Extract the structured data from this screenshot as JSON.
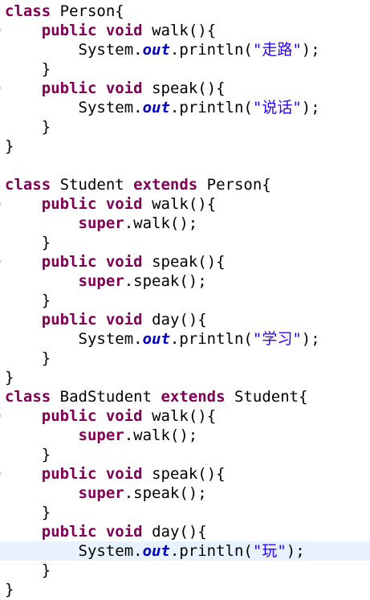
{
  "editor": {
    "current_line": 28,
    "lines": [
      {
        "indent": 0,
        "tokens": [
          {
            "t": "class",
            "c": "kw"
          },
          {
            "t": " Person{",
            "c": "plain"
          }
        ]
      },
      {
        "indent": 1,
        "mark": true,
        "tokens": [
          {
            "t": "public",
            "c": "kw"
          },
          {
            "t": " ",
            "c": "plain"
          },
          {
            "t": "void",
            "c": "kw"
          },
          {
            "t": " walk(){",
            "c": "plain"
          }
        ]
      },
      {
        "indent": 2,
        "tokens": [
          {
            "t": "System.",
            "c": "plain"
          },
          {
            "t": "out",
            "c": "fld"
          },
          {
            "t": ".println(",
            "c": "plain"
          },
          {
            "t": "\"走路\"",
            "c": "str"
          },
          {
            "t": ");",
            "c": "plain"
          }
        ]
      },
      {
        "indent": 1,
        "tokens": [
          {
            "t": "}",
            "c": "plain"
          }
        ]
      },
      {
        "indent": 1,
        "mark": true,
        "tokens": [
          {
            "t": "public",
            "c": "kw"
          },
          {
            "t": " ",
            "c": "plain"
          },
          {
            "t": "void",
            "c": "kw"
          },
          {
            "t": " speak(){",
            "c": "plain"
          }
        ]
      },
      {
        "indent": 2,
        "tokens": [
          {
            "t": "System.",
            "c": "plain"
          },
          {
            "t": "out",
            "c": "fld"
          },
          {
            "t": ".println(",
            "c": "plain"
          },
          {
            "t": "\"说话\"",
            "c": "str"
          },
          {
            "t": ");",
            "c": "plain"
          }
        ]
      },
      {
        "indent": 1,
        "tokens": [
          {
            "t": "}",
            "c": "plain"
          }
        ]
      },
      {
        "indent": 0,
        "tokens": [
          {
            "t": "}",
            "c": "plain"
          }
        ]
      },
      {
        "indent": 0,
        "tokens": []
      },
      {
        "indent": 0,
        "tokens": [
          {
            "t": "class",
            "c": "kw"
          },
          {
            "t": " Student ",
            "c": "plain"
          },
          {
            "t": "extends",
            "c": "kw"
          },
          {
            "t": " Person{",
            "c": "plain"
          }
        ]
      },
      {
        "indent": 1,
        "mark": true,
        "tokens": [
          {
            "t": "public",
            "c": "kw"
          },
          {
            "t": " ",
            "c": "plain"
          },
          {
            "t": "void",
            "c": "kw"
          },
          {
            "t": " walk(){",
            "c": "plain"
          }
        ]
      },
      {
        "indent": 2,
        "tokens": [
          {
            "t": "super",
            "c": "kw"
          },
          {
            "t": ".walk();",
            "c": "plain"
          }
        ]
      },
      {
        "indent": 1,
        "tokens": [
          {
            "t": "}",
            "c": "plain"
          }
        ]
      },
      {
        "indent": 1,
        "mark": true,
        "tokens": [
          {
            "t": "public",
            "c": "kw"
          },
          {
            "t": " ",
            "c": "plain"
          },
          {
            "t": "void",
            "c": "kw"
          },
          {
            "t": " speak(){",
            "c": "plain"
          }
        ]
      },
      {
        "indent": 2,
        "tokens": [
          {
            "t": "super",
            "c": "kw"
          },
          {
            "t": ".speak();",
            "c": "plain"
          }
        ]
      },
      {
        "indent": 1,
        "tokens": [
          {
            "t": "}",
            "c": "plain"
          }
        ]
      },
      {
        "indent": 1,
        "tokens": [
          {
            "t": "public",
            "c": "kw"
          },
          {
            "t": " ",
            "c": "plain"
          },
          {
            "t": "void",
            "c": "kw"
          },
          {
            "t": " day(){",
            "c": "plain"
          }
        ]
      },
      {
        "indent": 2,
        "tokens": [
          {
            "t": "System.",
            "c": "plain"
          },
          {
            "t": "out",
            "c": "fld"
          },
          {
            "t": ".println(",
            "c": "plain"
          },
          {
            "t": "\"学习\"",
            "c": "str"
          },
          {
            "t": ");",
            "c": "plain"
          }
        ]
      },
      {
        "indent": 1,
        "tokens": [
          {
            "t": "}",
            "c": "plain"
          }
        ]
      },
      {
        "indent": 0,
        "tokens": [
          {
            "t": "}",
            "c": "plain"
          }
        ]
      },
      {
        "indent": 0,
        "tokens": [
          {
            "t": "class",
            "c": "kw"
          },
          {
            "t": " BadStudent ",
            "c": "plain"
          },
          {
            "t": "extends",
            "c": "kw"
          },
          {
            "t": " Student{",
            "c": "plain"
          }
        ]
      },
      {
        "indent": 1,
        "mark": true,
        "tokens": [
          {
            "t": "public",
            "c": "kw"
          },
          {
            "t": " ",
            "c": "plain"
          },
          {
            "t": "void",
            "c": "kw"
          },
          {
            "t": " walk(){",
            "c": "plain"
          }
        ]
      },
      {
        "indent": 2,
        "tokens": [
          {
            "t": "super",
            "c": "kw"
          },
          {
            "t": ".walk();",
            "c": "plain"
          }
        ]
      },
      {
        "indent": 1,
        "tokens": [
          {
            "t": "}",
            "c": "plain"
          }
        ]
      },
      {
        "indent": 1,
        "mark": true,
        "tokens": [
          {
            "t": "public",
            "c": "kw"
          },
          {
            "t": " ",
            "c": "plain"
          },
          {
            "t": "void",
            "c": "kw"
          },
          {
            "t": " speak(){",
            "c": "plain"
          }
        ]
      },
      {
        "indent": 2,
        "tokens": [
          {
            "t": "super",
            "c": "kw"
          },
          {
            "t": ".speak();",
            "c": "plain"
          }
        ]
      },
      {
        "indent": 1,
        "tokens": [
          {
            "t": "}",
            "c": "plain"
          }
        ]
      },
      {
        "indent": 1,
        "tokens": [
          {
            "t": "public",
            "c": "kw"
          },
          {
            "t": " ",
            "c": "plain"
          },
          {
            "t": "void",
            "c": "kw"
          },
          {
            "t": " day(){",
            "c": "plain"
          }
        ]
      },
      {
        "indent": 2,
        "tokens": [
          {
            "t": "System.",
            "c": "plain"
          },
          {
            "t": "out",
            "c": "fld"
          },
          {
            "t": ".println(",
            "c": "plain"
          },
          {
            "t": "\"玩\"",
            "c": "str"
          },
          {
            "t": ");",
            "c": "plain"
          }
        ]
      },
      {
        "indent": 1,
        "tokens": [
          {
            "t": "}",
            "c": "plain"
          }
        ]
      },
      {
        "indent": 0,
        "tokens": [
          {
            "t": "}",
            "c": "plain"
          }
        ]
      }
    ],
    "colors": {
      "keyword": "#7f0055",
      "field": "#0000c0",
      "string": "#2a00ff",
      "current_line_bg": "#e8f2fe",
      "text": "#000000"
    }
  }
}
